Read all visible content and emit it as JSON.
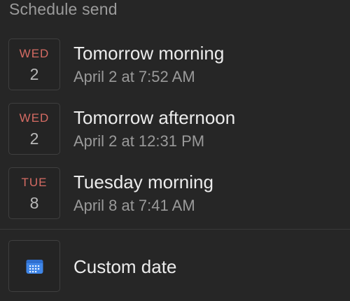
{
  "header": {
    "title": "Schedule send"
  },
  "options": [
    {
      "day_of_week": "WED",
      "day": "2",
      "title": "Tomorrow morning",
      "subtitle": "April 2 at 7:52 AM"
    },
    {
      "day_of_week": "WED",
      "day": "2",
      "title": "Tomorrow afternoon",
      "subtitle": "April 2 at 12:31 PM"
    },
    {
      "day_of_week": "TUE",
      "day": "8",
      "title": "Tuesday morning",
      "subtitle": "April 8 at 7:41 AM"
    }
  ],
  "custom": {
    "label": "Custom date",
    "icon": "calendar-icon"
  },
  "colors": {
    "background": "#262626",
    "day_of_week": "#d56b63",
    "calendar_icon": "#3f86e8",
    "tile_border": "#3f3f3f"
  }
}
